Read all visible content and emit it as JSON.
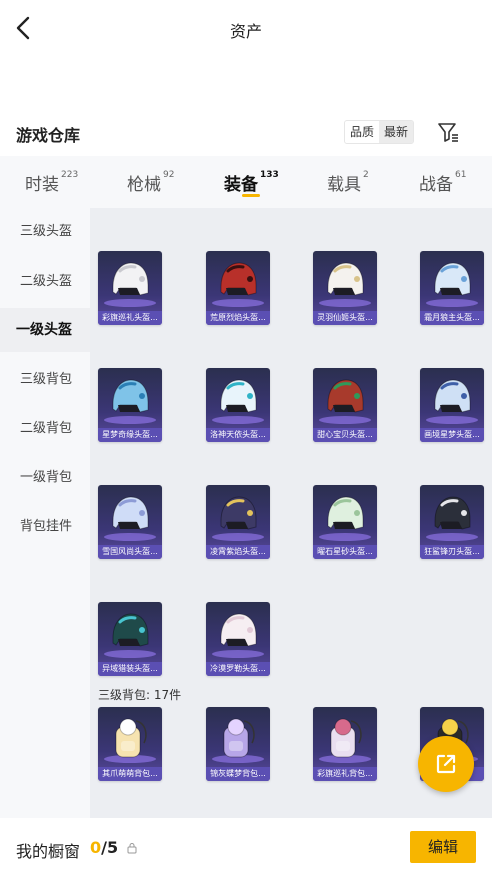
{
  "header": {
    "title": "资产"
  },
  "section": {
    "title": "游戏仓库",
    "sort_options": [
      "品质",
      "最新"
    ],
    "sort_active": 1
  },
  "tabs": [
    {
      "label": "时装",
      "count": "223"
    },
    {
      "label": "枪械",
      "count": "92"
    },
    {
      "label": "装备",
      "count": "133"
    },
    {
      "label": "载具",
      "count": "2"
    },
    {
      "label": "战备",
      "count": "61"
    }
  ],
  "active_tab": 2,
  "sidebar": {
    "items": [
      "三级头盔",
      "二级头盔",
      "一级头盔",
      "三级背包",
      "二级背包",
      "一级背包",
      "背包挂件"
    ],
    "active": 2
  },
  "items": [
    {
      "name": "彩旗巡礼头盔...",
      "icon": "helmet-icon",
      "color": "#f2f2f4",
      "accent": "#c9c9cf"
    },
    {
      "name": "荒原烈焰头盔...",
      "icon": "helmet-icon",
      "color": "#b8302a",
      "accent": "#3a1010"
    },
    {
      "name": "灵羽仙姬头盔...",
      "icon": "helmet-icon",
      "color": "#f4f2ee",
      "accent": "#d8c38a"
    },
    {
      "name": "霜月狼主头盔...",
      "icon": "helmet-icon",
      "color": "#d9e8f8",
      "accent": "#6aa2d8"
    },
    {
      "name": "星梦奇缘头盔...",
      "icon": "helmet-icon",
      "color": "#7fc3e8",
      "accent": "#2a7fb5"
    },
    {
      "name": "洛神天依头盔...",
      "icon": "helmet-icon",
      "color": "#e8f4fb",
      "accent": "#2fb3c7"
    },
    {
      "name": "甜心宝贝头盔...",
      "icon": "helmet-icon",
      "color": "#a83a2c",
      "accent": "#2f9a5a"
    },
    {
      "name": "画境星梦头盔...",
      "icon": "helmet-icon",
      "color": "#cfe0f5",
      "accent": "#3e5fa8"
    },
    {
      "name": "雪国风尚头盔...",
      "icon": "helmet-icon",
      "color": "#cfdcf7",
      "accent": "#8d9bd6"
    },
    {
      "name": "凌霄紫焰头盔...",
      "icon": "helmet-icon",
      "color": "#3d3a66",
      "accent": "#e4c35c"
    },
    {
      "name": "曜石星砂头盔...",
      "icon": "helmet-icon",
      "color": "#dff0df",
      "accent": "#9bc59b"
    },
    {
      "name": "狂鲨锋刃头盔...",
      "icon": "helmet-icon",
      "color": "#2b2f3a",
      "accent": "#e6e6ea"
    },
    {
      "name": "异域猎装头盔...",
      "icon": "helmet-icon",
      "color": "#1f4a4a",
      "accent": "#48c4d0"
    },
    {
      "name": "冷漠罗勒头盔...",
      "icon": "helmet-icon",
      "color": "#f6eef2",
      "accent": "#e2c9d6"
    }
  ],
  "group_label": "三级背包: 17件",
  "backpacks": [
    {
      "name": "其爪萌萌背包...",
      "icon": "backpack-icon",
      "color": "#f6e3b0",
      "accent": "#ffffff"
    },
    {
      "name": "锦灰蝶梦背包...",
      "icon": "backpack-icon",
      "color": "#b7a6e8",
      "accent": "#e4d3ff"
    },
    {
      "name": "彩旗巡礼背包...",
      "icon": "backpack-icon",
      "color": "#e9dff0",
      "accent": "#d76a8c"
    },
    {
      "name": "",
      "icon": "backpack-icon",
      "color": "#2a2a2a",
      "accent": "#f7d24a"
    }
  ],
  "footer": {
    "label": "我的橱窗",
    "current": "0",
    "total": "/5",
    "edit_label": "编辑"
  },
  "colors": {
    "accent": "#f7b500",
    "label_bg": "#5b4fb3"
  }
}
